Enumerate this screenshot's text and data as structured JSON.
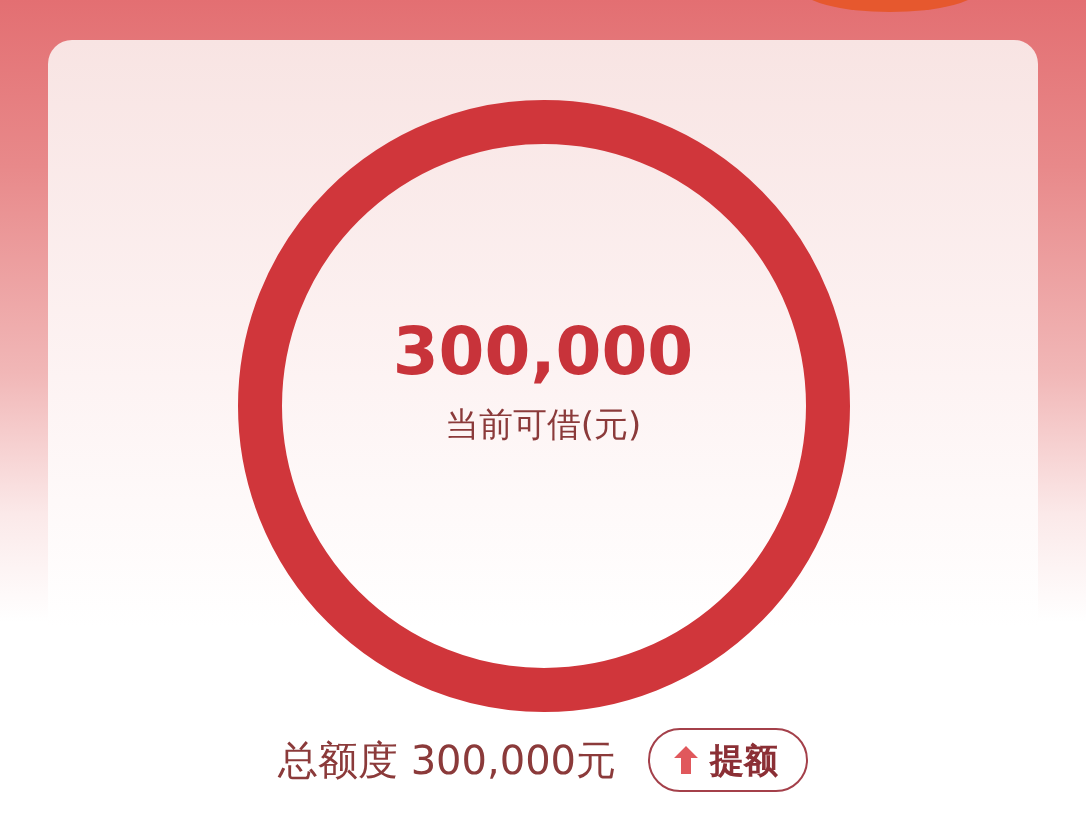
{
  "credit": {
    "amount": "300,000",
    "caption": "当前可借(元)"
  },
  "total": {
    "label": "总额度 300,000元",
    "button": "提额"
  }
}
